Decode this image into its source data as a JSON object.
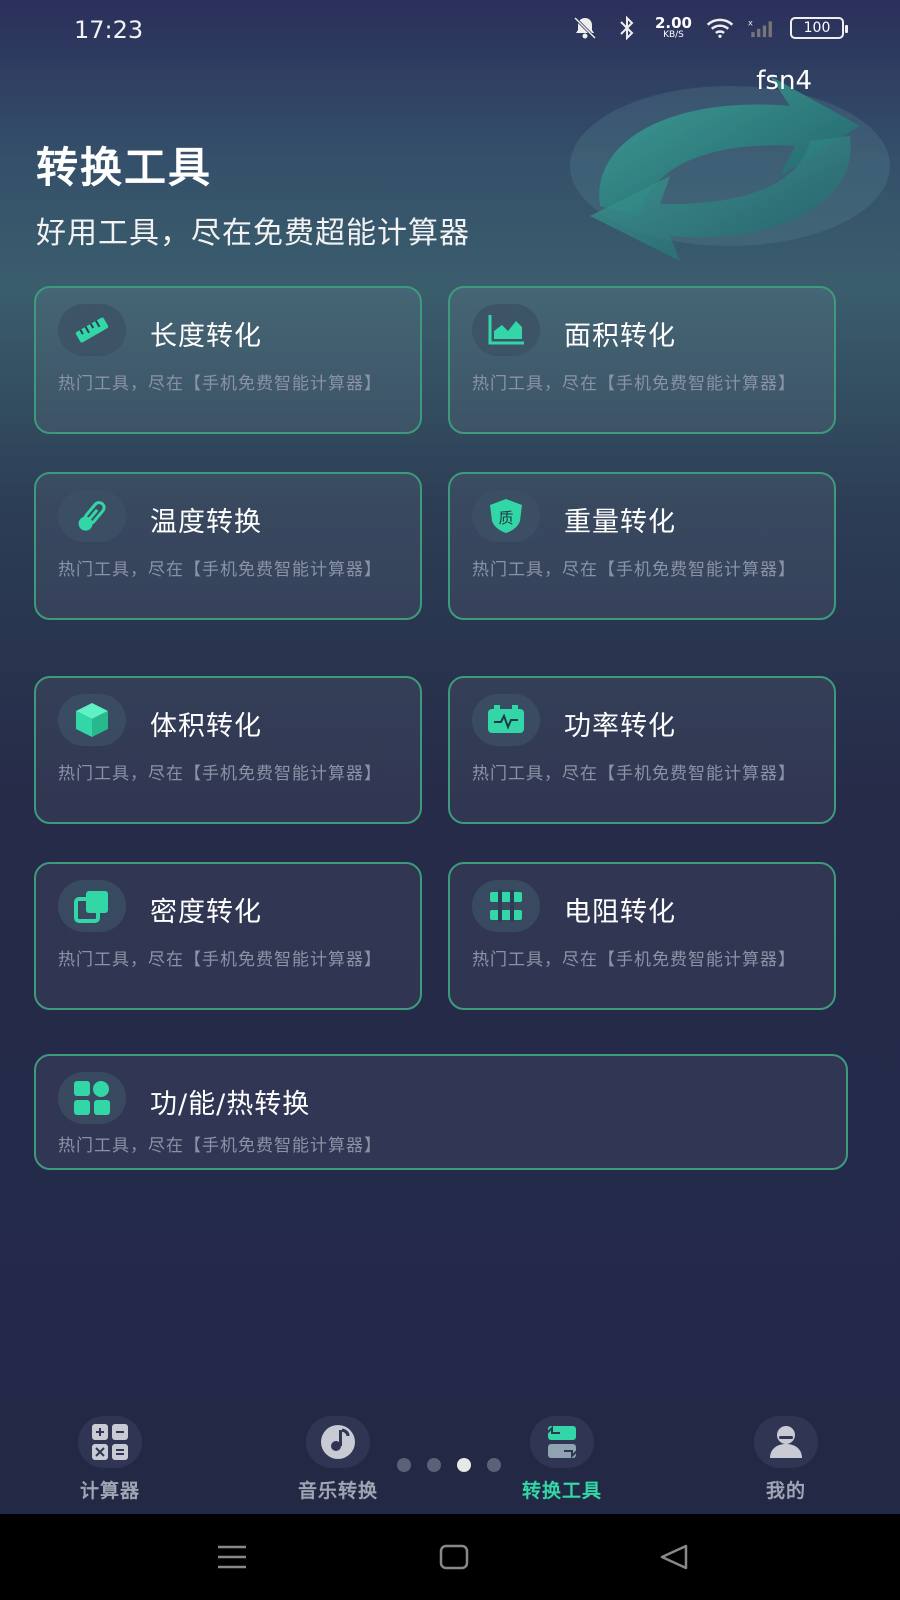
{
  "status_bar": {
    "time": "17:23",
    "net_speed_value": "2.00",
    "net_speed_unit": "KB/S",
    "battery": "100"
  },
  "header": {
    "user_name": "fsn4",
    "title": "转换工具",
    "subtitle": "好用工具，尽在免费超能计算器"
  },
  "tools": [
    {
      "label": "长度转化",
      "desc": "热门工具，尽在【手机免费智能计算器】",
      "icon": "ruler-icon"
    },
    {
      "label": "面积转化",
      "desc": "热门工具，尽在【手机免费智能计算器】",
      "icon": "area-chart-icon"
    },
    {
      "label": "温度转换",
      "desc": "热门工具，尽在【手机免费智能计算器】",
      "icon": "thermometer-icon"
    },
    {
      "label": "重量转化",
      "desc": "热门工具，尽在【手机免费智能计算器】",
      "icon": "shield-quality-icon",
      "icon_text": "质"
    },
    {
      "label": "体积转化",
      "desc": "热门工具，尽在【手机免费智能计算器】",
      "icon": "cube-icon"
    },
    {
      "label": "功率转化",
      "desc": "热门工具，尽在【手机免费智能计算器】",
      "icon": "battery-pulse-icon"
    },
    {
      "label": "密度转化",
      "desc": "热门工具，尽在【手机免费智能计算器】",
      "icon": "overlap-squares-icon"
    },
    {
      "label": "电阻转化",
      "desc": "热门工具，尽在【手机免费智能计算器】",
      "icon": "resistor-icon"
    },
    {
      "label": "功/能/热转换",
      "desc": "热门工具，尽在【手机免费智能计算器】",
      "icon": "grid-apps-icon"
    }
  ],
  "bottom_nav": [
    {
      "label": "计算器",
      "icon": "calculator-icon",
      "active": false
    },
    {
      "label": "音乐转换",
      "icon": "music-disc-icon",
      "active": false
    },
    {
      "label": "转换工具",
      "icon": "convert-icon",
      "active": true
    },
    {
      "label": "我的",
      "icon": "user-icon",
      "active": false
    }
  ],
  "colors": {
    "accent": "#33d6a6",
    "card_border": "#3e9a7d",
    "background": "#23284a"
  }
}
